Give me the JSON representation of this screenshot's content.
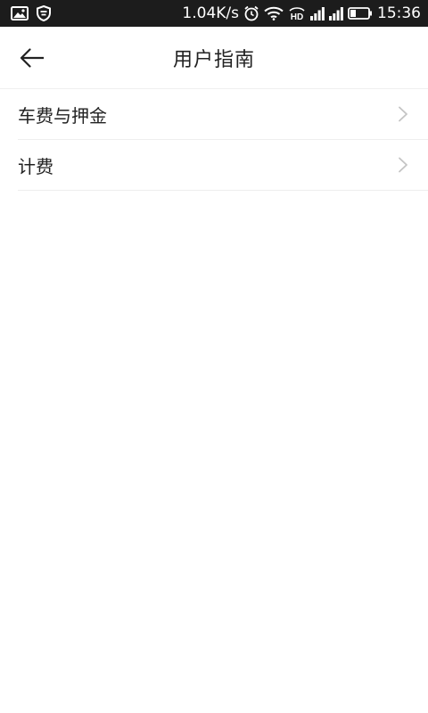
{
  "status_bar": {
    "network_speed": "1.04K/s",
    "time": "15:36",
    "icons": [
      "gallery-icon",
      "shield-icon",
      "alarm-icon",
      "wifi-icon",
      "hd-icon",
      "signal-icon",
      "signal-icon",
      "battery-icon"
    ]
  },
  "header": {
    "title": "用户指南",
    "back_icon": "back-arrow-icon"
  },
  "list": {
    "items": [
      {
        "label": "车费与押金",
        "icon": "chevron-right-icon"
      },
      {
        "label": "计费",
        "icon": "chevron-right-icon"
      }
    ]
  },
  "colors": {
    "status_bar_bg": "#1c1c1c",
    "background": "#ffffff",
    "text": "#222222",
    "divider": "#eeeeee",
    "chevron": "#c4c4c4"
  }
}
